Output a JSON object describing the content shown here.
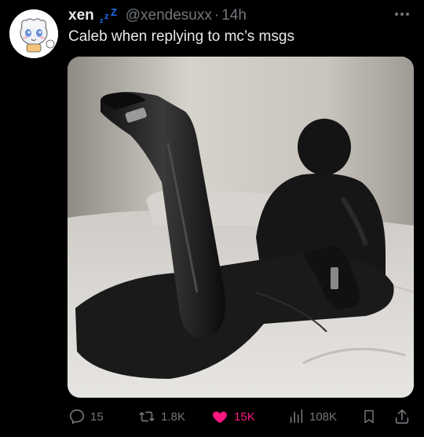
{
  "tweet": {
    "author": {
      "display_name": "xen",
      "status_icon": "zzz-sleep-icon",
      "handle": "@xendesuxx",
      "separator": "·",
      "time": "14h",
      "avatar_icon": "anime-character-avatar"
    },
    "text": "Caleb when replying to mc’s msgs",
    "media": {
      "description_icon": "photo-person-lying-on-bed-with-boots"
    },
    "actions": {
      "replies": "15",
      "retweets": "1.8K",
      "likes": "15K",
      "views": "108K"
    },
    "colors": {
      "background": "#000000",
      "text": "#e7e9ea",
      "secondary": "#71767b",
      "like_active": "#f91880",
      "zzz": "#1d6ff2"
    }
  }
}
